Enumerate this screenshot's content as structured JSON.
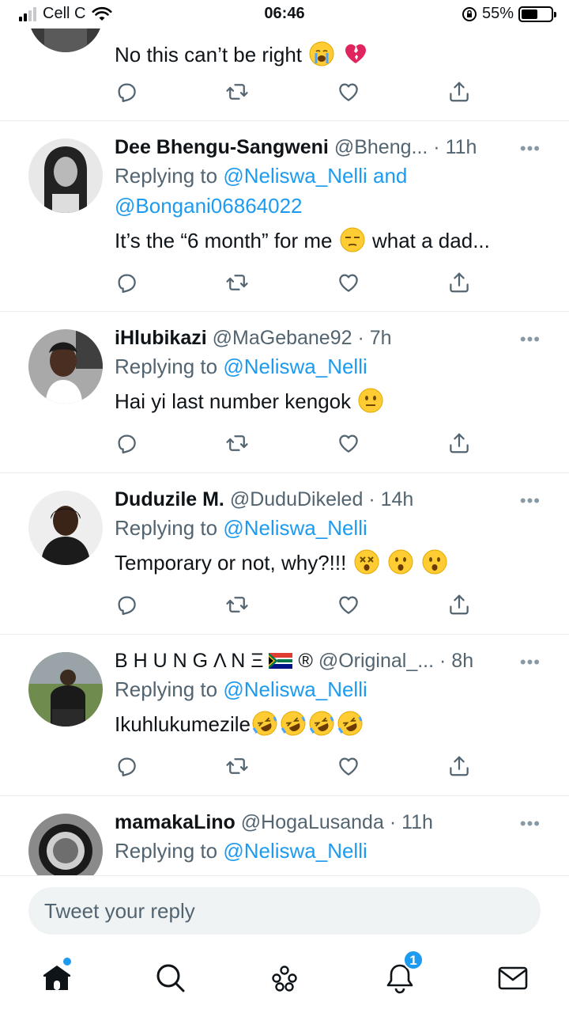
{
  "status_bar": {
    "carrier": "Cell C",
    "time": "06:46",
    "battery": "55%",
    "battery_level": 0.55
  },
  "tweets": [
    {
      "text": "No this can’t be right",
      "emojis": [
        "loudly-crying-face-emoji",
        "broken-heart-emoji"
      ]
    },
    {
      "name": "Dee Bhengu-Sangweni",
      "handle": "@Bheng...",
      "time": "· 11h",
      "replying_prefix": "Replying to",
      "mention_1": "@Neliswa_Nelli",
      "and": "and",
      "mention_2": "@Bongani06864022",
      "text_before": "It’s the “6 month” for me",
      "text_after": "what a dad...",
      "emojis": [
        "unamused-face-emoji"
      ]
    },
    {
      "name": "iHlubikazi",
      "handle": "@MaGebane92",
      "time": "· 7h",
      "replying_prefix": "Replying to",
      "mention_1": "@Neliswa_Nelli",
      "text": "Hai yi last number kengok",
      "emojis": [
        "neutral-face-emoji"
      ]
    },
    {
      "name": "Duduzile M.",
      "handle": "@DuduDikeled",
      "time": "· 14h",
      "replying_prefix": "Replying to",
      "mention_1": "@Neliswa_Nelli",
      "text": "Temporary or not, why?!!!",
      "emojis": [
        "dizzy-face-emoji",
        "astonished-face-emoji",
        "astonished-face-emoji"
      ]
    },
    {
      "name": "B H U N G Λ N Ξ",
      "name_suffix": "®",
      "handle": "@Original_...",
      "time": "· 8h",
      "replying_prefix": "Replying to",
      "mention_1": "@Neliswa_Nelli",
      "text": "Ikuhlukumezile",
      "emojis": [
        "rofl-emoji",
        "rofl-emoji",
        "rofl-emoji",
        "rofl-emoji"
      ]
    },
    {
      "name": "mamakaLino",
      "handle": "@HogaLusanda",
      "time": "· 11h",
      "replying_prefix": "Replying to",
      "mention_1": "@Neliswa_Nelli"
    }
  ],
  "more_label": "•••",
  "reply": {
    "placeholder": "Tweet your reply"
  },
  "nav": {
    "notifications_badge": "1"
  },
  "colors": {
    "accent": "#1d9bf0",
    "muted": "#536471",
    "icon": "#536471"
  }
}
